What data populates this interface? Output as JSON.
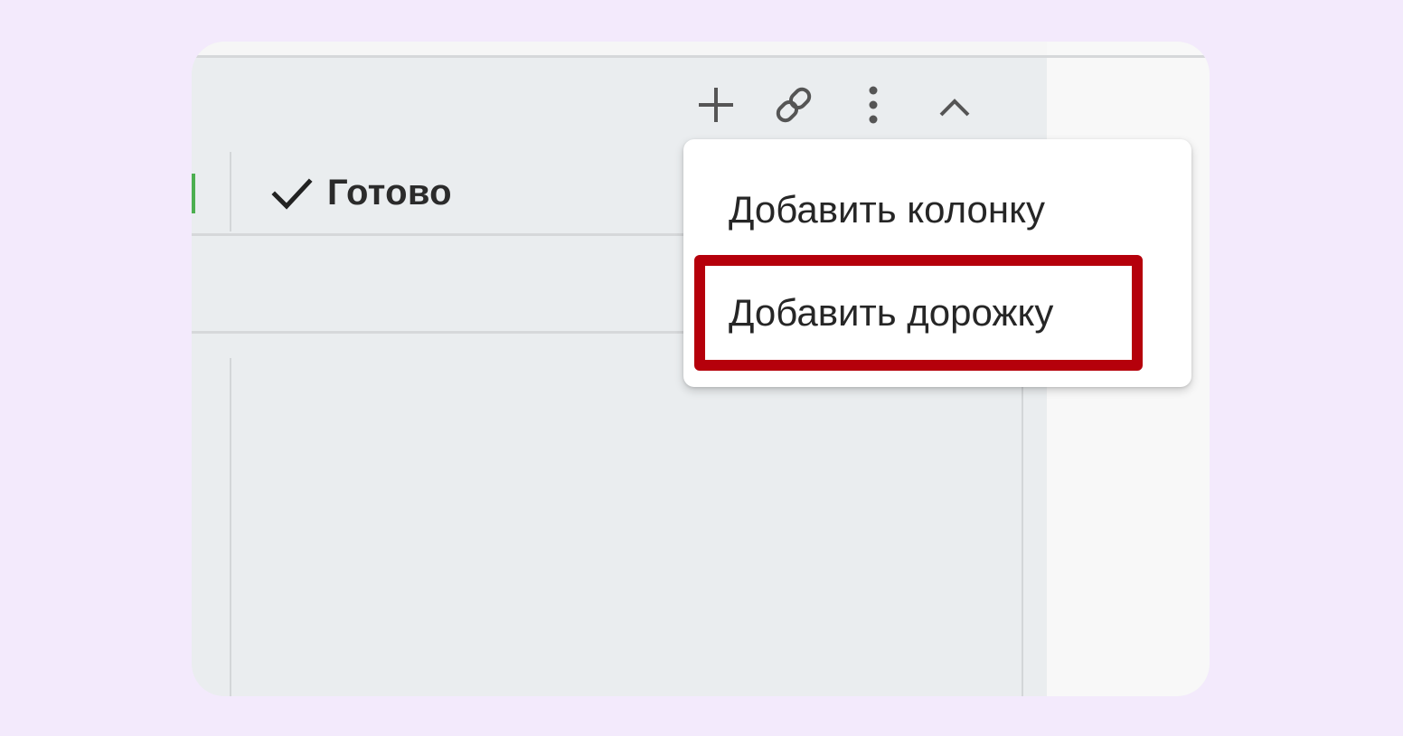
{
  "column": {
    "title": "Готово",
    "icon": "check-icon"
  },
  "toolbar": {
    "add_icon": "plus-icon",
    "link_icon": "link-icon",
    "more_icon": "more-vertical-icon",
    "collapse_icon": "chevron-up-icon"
  },
  "menu": {
    "items": [
      {
        "label": "Добавить колонку"
      },
      {
        "label": "Добавить дорожку",
        "highlighted": true
      }
    ]
  },
  "colors": {
    "page_background": "#f3eafc",
    "board_background": "#eaedef",
    "highlight": "#b5000b",
    "status_accent": "#4caf50"
  }
}
